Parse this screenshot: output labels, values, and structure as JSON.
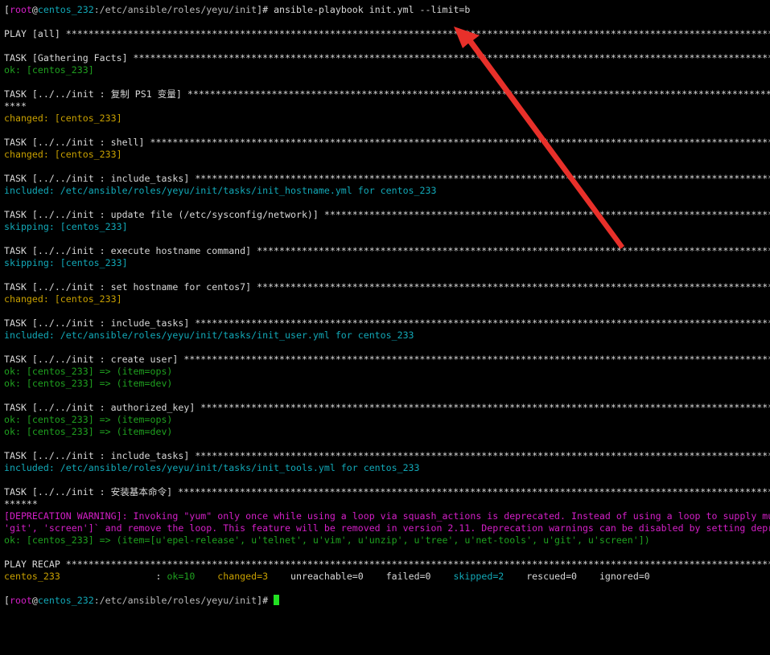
{
  "terminal": {
    "prompt1": {
      "open": "[",
      "user": "root",
      "at": "@",
      "host": "centos_232",
      "path": ":/etc/ansible/roles/yeyu/init",
      "close": "]# ",
      "command": "ansible-playbook init.yml --limit=b"
    },
    "play_all": "PLAY [all] ******************************************************************************************************************************",
    "tasks": [
      {
        "header": "TASK [Gathering Facts] ******************************************************************************************************************",
        "results": [
          {
            "text": "ok: [centos_233]",
            "style": "ok"
          }
        ]
      },
      {
        "header": "TASK [../../init : 复制 PS1 变量] ************************************************************************************************************",
        "header_cont": "****",
        "results": [
          {
            "text": "changed: [centos_233]",
            "style": "changed"
          }
        ]
      },
      {
        "header": "TASK [../../init : shell] ***************************************************************************************************************",
        "results": [
          {
            "text": "changed: [centos_233]",
            "style": "changed"
          }
        ]
      },
      {
        "header": "TASK [../../init : include_tasks] *******************************************************************************************************",
        "results": [
          {
            "text": "included: /etc/ansible/roles/yeyu/init/tasks/init_hostname.yml for centos_233",
            "style": "included"
          }
        ]
      },
      {
        "header": "TASK [../../init : update file (/etc/sysconfig/network)] ********************************************************************************",
        "results": [
          {
            "text": "skipping: [centos_233]",
            "style": "skipping"
          }
        ]
      },
      {
        "header": "TASK [../../init : execute hostname command] ********************************************************************************************",
        "results": [
          {
            "text": "skipping: [centos_233]",
            "style": "skipping"
          }
        ]
      },
      {
        "header": "TASK [../../init : set hostname for centos7] ********************************************************************************************",
        "results": [
          {
            "text": "changed: [centos_233]",
            "style": "changed"
          }
        ]
      },
      {
        "header": "TASK [../../init : include_tasks] *******************************************************************************************************",
        "results": [
          {
            "text": "included: /etc/ansible/roles/yeyu/init/tasks/init_user.yml for centos_233",
            "style": "included"
          }
        ]
      },
      {
        "header": "TASK [../../init : create user] *********************************************************************************************************",
        "results": [
          {
            "text": "ok: [centos_233] => (item=ops)",
            "style": "ok"
          },
          {
            "text": "ok: [centos_233] => (item=dev)",
            "style": "ok"
          }
        ]
      },
      {
        "header": "TASK [../../init : authorized_key] ******************************************************************************************************",
        "results": [
          {
            "text": "ok: [centos_233] => (item=ops)",
            "style": "ok"
          },
          {
            "text": "ok: [centos_233] => (item=dev)",
            "style": "ok"
          }
        ]
      },
      {
        "header": "TASK [../../init : include_tasks] *******************************************************************************************************",
        "results": [
          {
            "text": "included: /etc/ansible/roles/yeyu/init/tasks/init_tools.yml for centos_233",
            "style": "included"
          }
        ]
      },
      {
        "header": "TASK [../../init : 安装基本命令] *************************************************************************************************************",
        "header_cont": "******",
        "results": [
          {
            "text": "[DEPRECATION WARNING]: Invoking \"yum\" only once while using a loop via squash_actions is deprecated. Instead of using a loop to supply multiple",
            "style": "warning"
          },
          {
            "text": "'git', 'screen']` and remove the loop. This feature will be removed in version 2.11. Deprecation warnings can be disabled by setting deprecation_warnings",
            "style": "warning"
          },
          {
            "text": "ok: [centos_233] => (item=[u'epel-release', u'telnet', u'vim', u'unzip', u'tree', u'net-tools', u'git', u'screen'])",
            "style": "ok"
          }
        ]
      }
    ],
    "recap": {
      "header": "PLAY RECAP ******************************************************************************************************************************",
      "host": "centos_233",
      "gap": "                 : ",
      "ok": "ok=10",
      "changed": "changed=3",
      "unreachable": "unreachable=0",
      "failed": "failed=0",
      "skipped": "skipped=2",
      "rescued": "rescued=0",
      "ignored": "ignored=0"
    },
    "prompt2": {
      "open": "[",
      "user": "root",
      "at": "@",
      "host": "centos_232",
      "path": ":/etc/ansible/roles/yeyu/init",
      "close": "]# "
    },
    "colors": {
      "background": "#000000",
      "default_text": "#d8d8d8",
      "ok": "#1fa01f",
      "changed": "#c8a000",
      "included_skipping": "#12a9b8",
      "warning": "#d41fc7",
      "cursor": "#22e022",
      "annotation_arrow": "#e8302a"
    }
  }
}
